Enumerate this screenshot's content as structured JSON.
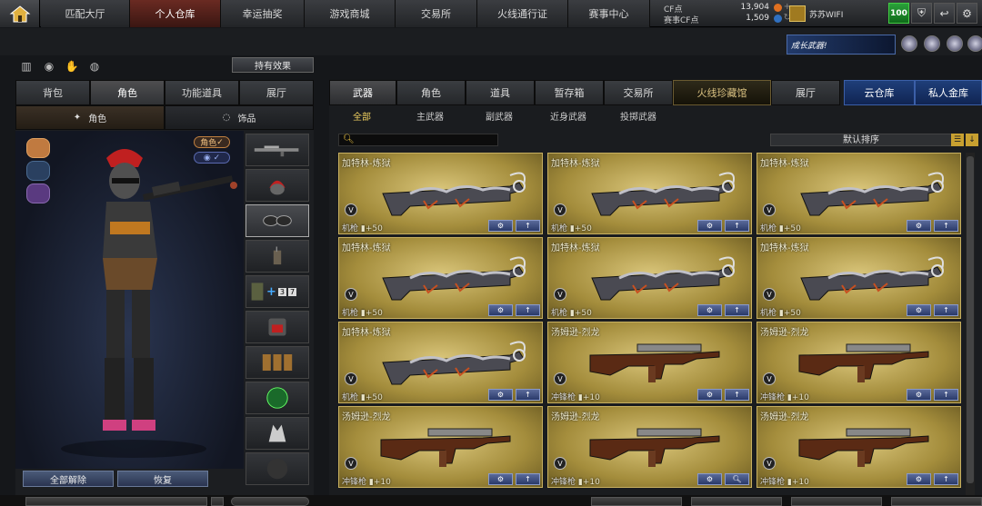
{
  "nav": {
    "tabs": [
      {
        "label": "匹配大厅",
        "active": false
      },
      {
        "label": "个人仓库",
        "active": true
      },
      {
        "label": "幸运抽奖",
        "active": false
      },
      {
        "label": "游戏商城",
        "active": false
      },
      {
        "label": "交易所",
        "active": false
      },
      {
        "label": "火线通行证",
        "active": false
      },
      {
        "label": "赛事中心",
        "active": false
      }
    ]
  },
  "currency": {
    "cf_label": "CF点",
    "cf_value": "13,904",
    "event_label": "赛事CF点",
    "event_value": "1,509",
    "plus": "+"
  },
  "user": {
    "name": "苏苏WIFI",
    "level": "100"
  },
  "left": {
    "hold_button": "持有效果",
    "tabs": [
      "背包",
      "角色",
      "功能道具",
      "展厅"
    ],
    "subtabs": [
      "角色",
      "饰品"
    ],
    "badge_role": "角色",
    "bottom_buttons": [
      "全部解除",
      "恢复"
    ],
    "slot_badges": [
      "+",
      "3",
      "7"
    ]
  },
  "promo": "成长武器!",
  "right": {
    "tabs": [
      "武器",
      "角色",
      "道具",
      "暂存箱",
      "交易所",
      "火线珍藏馆",
      "展厅"
    ],
    "tabs_extra": [
      "云仓库",
      "私人金库"
    ],
    "filters": [
      "全部",
      "主武器",
      "副武器",
      "近身武器",
      "投掷武器"
    ],
    "sort": "默认排序"
  },
  "accent": {
    "gold": "#c8a030",
    "active_tab": "#6a2a22",
    "blue": "#1f3f7a"
  },
  "cards": [
    {
      "name": "加特林-炼狱",
      "cls": "机枪",
      "val": "+50",
      "gun": "gatling"
    },
    {
      "name": "加特林-炼狱",
      "cls": "机枪",
      "val": "+50",
      "gun": "gatling"
    },
    {
      "name": "加特林-炼狱",
      "cls": "机枪",
      "val": "+50",
      "gun": "gatling"
    },
    {
      "name": "加特林-炼狱",
      "cls": "机枪",
      "val": "+50",
      "gun": "gatling"
    },
    {
      "name": "加特林-炼狱",
      "cls": "机枪",
      "val": "+50",
      "gun": "gatling"
    },
    {
      "name": "加特林-炼狱",
      "cls": "机枪",
      "val": "+50",
      "gun": "gatling"
    },
    {
      "name": "加特林-炼狱",
      "cls": "机枪",
      "val": "+50",
      "gun": "gatling"
    },
    {
      "name": "汤姆逊-烈龙",
      "cls": "冲锋枪",
      "val": "+10",
      "gun": "thompson"
    },
    {
      "name": "汤姆逊-烈龙",
      "cls": "冲锋枪",
      "val": "+10",
      "gun": "thompson"
    },
    {
      "name": "汤姆逊-烈龙",
      "cls": "冲锋枪",
      "val": "+10",
      "gun": "thompson"
    },
    {
      "name": "汤姆逊-烈龙",
      "cls": "冲锋枪",
      "val": "+10",
      "gun": "thompson"
    },
    {
      "name": "汤姆逊-烈龙",
      "cls": "冲锋枪",
      "val": "+10",
      "gun": "thompson"
    }
  ]
}
